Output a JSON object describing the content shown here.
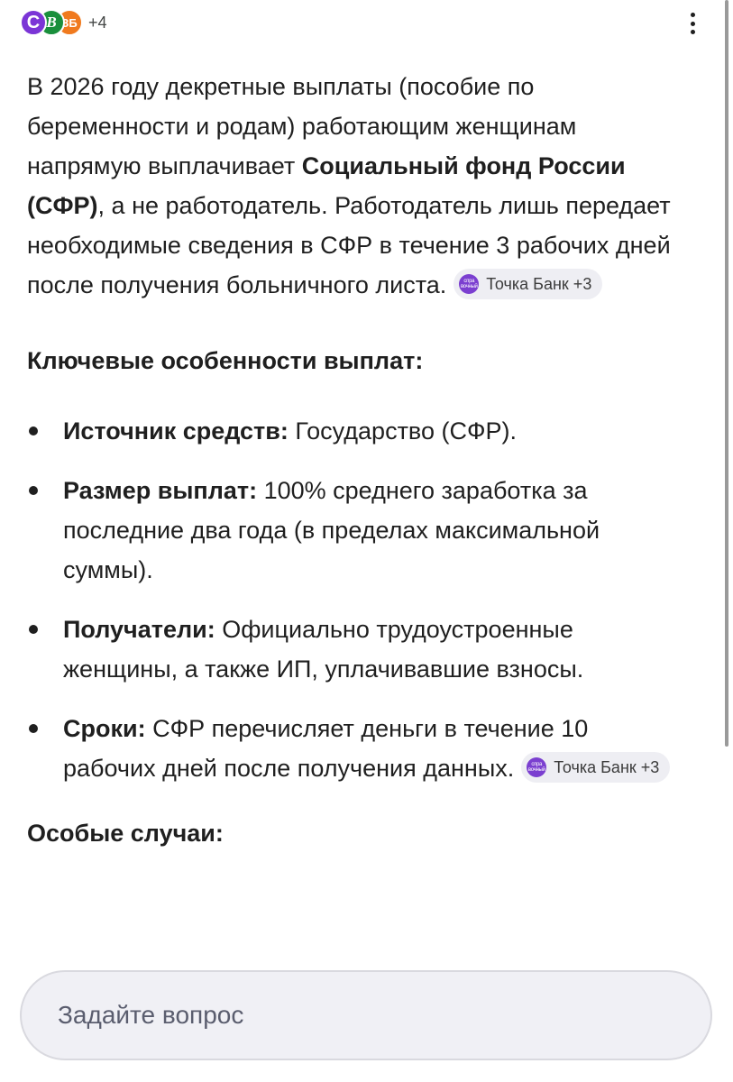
{
  "sources": {
    "icons": [
      {
        "letter": "C",
        "color": "#7b35d6",
        "name": "source-icon-1"
      },
      {
        "letter": "B",
        "color": "#1a8f3c",
        "name": "source-icon-2"
      },
      {
        "letter": "ЗБ",
        "color": "#f07a1e",
        "name": "source-icon-3"
      }
    ],
    "more": "+4"
  },
  "intro": {
    "part1": "В 2026 году декретные выплаты (пособие по беременности и родам) работающим женщинам напрямую выплачивает ",
    "bold": "Социальный фонд России (СФР)",
    "part2": ", а не работодатель. Работодатель лишь передает необходимые сведения в СФР в течение 3 рабочих дней после получения больничного листа.",
    "chip": "Точка Банк +3"
  },
  "key_heading": "Ключевые особенности выплат:",
  "bullets": [
    {
      "label": "Источник средств:",
      "text": " Государство (СФР)."
    },
    {
      "label": "Размер выплат:",
      "text": " 100% среднего заработка за последние два года (в пределах максимальной суммы)."
    },
    {
      "label": "Получатели:",
      "text": " Официально трудоустроенные женщины, а также ИП, уплачивавшие взносы."
    },
    {
      "label": "Сроки:",
      "text": " СФР перечисляет деньги в течение 10 рабочих дней после получения данных.",
      "chip": "Точка Банк +3"
    }
  ],
  "special_heading": "Особые случаи:",
  "chip_logo_text": "спра вочный",
  "ask": {
    "placeholder": "Задайте вопрос"
  },
  "colors": {
    "accent": "#7b3fd0",
    "chip_bg": "#eeeef3",
    "input_bg": "#f0f0f5"
  }
}
